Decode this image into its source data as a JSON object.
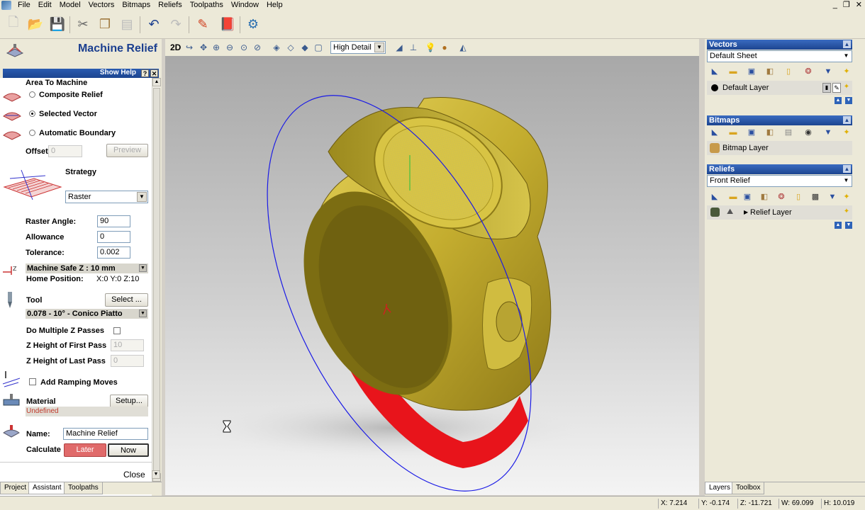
{
  "menu": [
    "File",
    "Edit",
    "Model",
    "Vectors",
    "Bitmaps",
    "Reliefs",
    "Toolpaths",
    "Window",
    "Help"
  ],
  "panel": {
    "title": "Machine Relief",
    "show_help": "Show Help",
    "help_q": "?",
    "close_x": "✕",
    "area_to_machine": "Area To Machine",
    "opt_composite": "Composite Relief",
    "opt_selected": "Selected Vector",
    "opt_auto": "Automatic Boundary",
    "offset_label": "Offset",
    "offset_value": "0",
    "preview": "Preview",
    "strategy_label": "Strategy",
    "strategy_value": "Raster",
    "raster_angle_label": "Raster Angle:",
    "raster_angle_value": "90",
    "allowance_label": "Allowance",
    "allowance_value": "0",
    "tolerance_label": "Tolerance:",
    "tolerance_value": "0.002",
    "safe_z": "Machine Safe Z : 10 mm",
    "home_label": "Home Position:",
    "home_value": "X:0 Y:0 Z:10",
    "tool_label": "Tool",
    "tool_select": "Select ...",
    "tool_value": "0.078 - 10° - Conico Piatto",
    "multi_z_label": "Do Multiple Z Passes",
    "first_pass_label": "Z Height of First Pass",
    "first_pass_value": "10",
    "last_pass_label": "Z Height of Last Pass",
    "last_pass_value": "0",
    "ramping_label": "Add Ramping Moves",
    "material_label": "Material",
    "material_setup": "Setup...",
    "material_state": "Undefined",
    "name_label": "Name:",
    "name_value": "Machine Relief",
    "calculate_label": "Calculate",
    "later": "Later",
    "now": "Now",
    "close": "Close"
  },
  "left_tabs": [
    "Project",
    "Assistant",
    "Toolpaths"
  ],
  "view_toolbar": {
    "mode_2d": "2D",
    "detail": "High Detail"
  },
  "vectors": {
    "title": "Vectors",
    "sheet": "Default Sheet",
    "layer": "Default Layer"
  },
  "bitmaps": {
    "title": "Bitmaps",
    "layer": "Bitmap Layer"
  },
  "reliefs": {
    "title": "Reliefs",
    "relief": "Front Relief",
    "layer": "Relief Layer"
  },
  "right_tabs": [
    "Layers",
    "Toolbox"
  ],
  "status": {
    "x": "X: 7.214",
    "y": "Y: -0.174",
    "z": "Z: -11.721",
    "w": "W: 69.099",
    "h": "H: 10.019"
  },
  "colors": {
    "accent": "#1d4590",
    "title": "#1b3f8f",
    "later_bg": "#e06a6a",
    "undefined_text": "#c0392b",
    "relief_gold": "#c9b43a",
    "toolpath_red": "#e8141b",
    "boundary_blue": "#1a1ae6"
  }
}
